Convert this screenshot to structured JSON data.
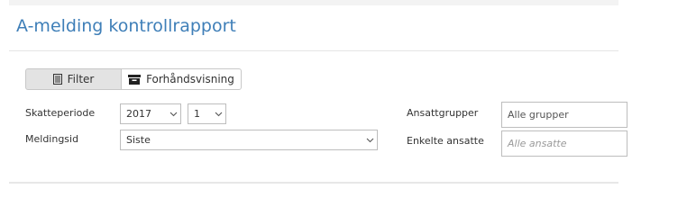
{
  "header": {
    "title": "A-melding kontrollrapport"
  },
  "tabs": {
    "filter_label": "Filter",
    "preview_label": "Forhåndsvisning"
  },
  "form": {
    "period_label": "Skatteperiode",
    "year_value": "2017",
    "month_value": "1",
    "message_label": "Meldingsid",
    "message_value": "Siste",
    "groups_label": "Ansattgrupper",
    "groups_placeholder": "Alle grupper",
    "employees_label": "Enkelte ansatte",
    "employees_placeholder": "Alle ansatte"
  },
  "icons": {
    "filter": "document-list-icon",
    "preview": "inbox-tray-icon",
    "dropdown": "chevron-down-icon"
  },
  "colors": {
    "title": "#3f7fb8",
    "active_tab_bg": "#e3e3e3"
  }
}
